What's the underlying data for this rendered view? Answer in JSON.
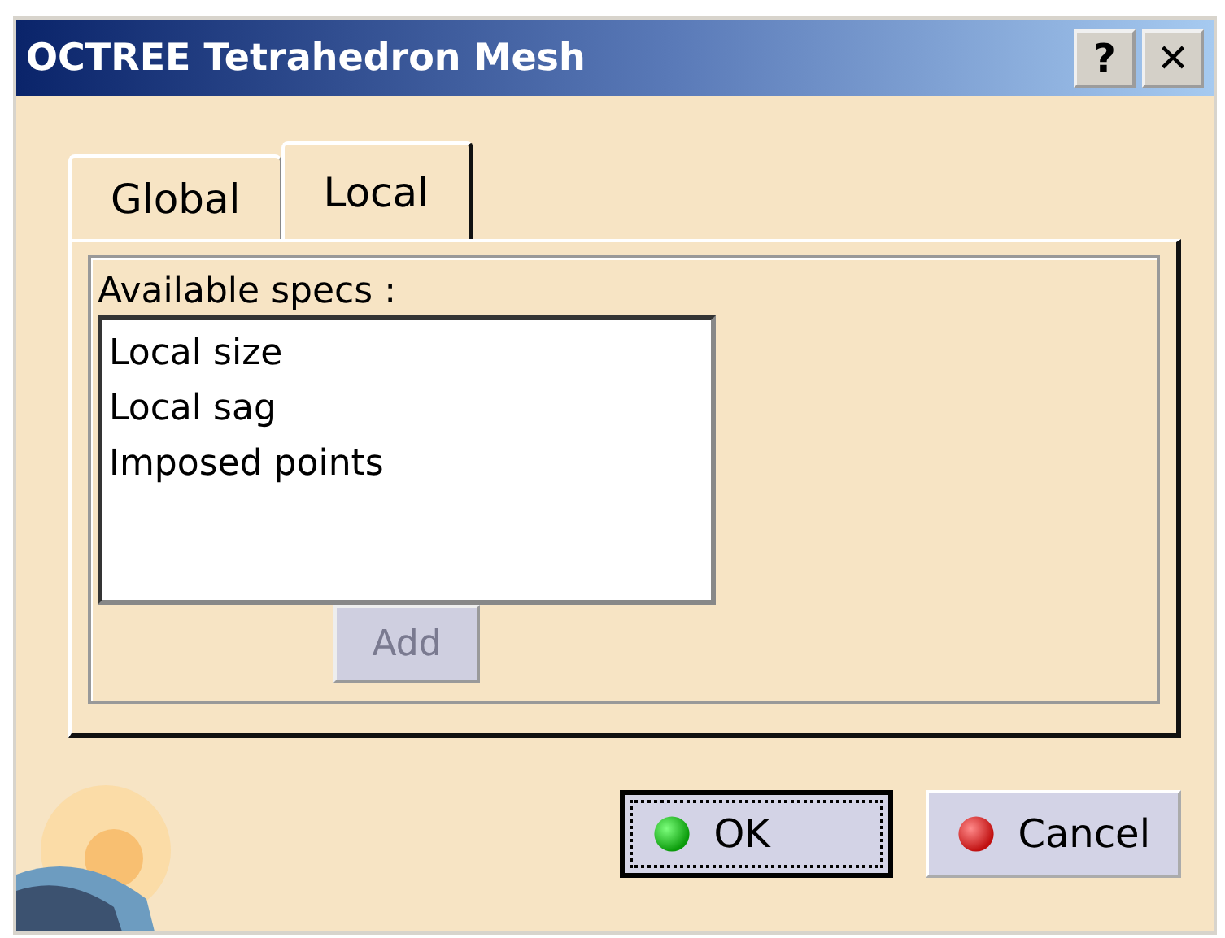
{
  "window": {
    "title": "OCTREE Tetrahedron Mesh",
    "title_buttons": [
      "?",
      "✕"
    ]
  },
  "tabs": [
    {
      "label": "Global",
      "selected": false
    },
    {
      "label": "Local",
      "selected": true
    }
  ],
  "specs": {
    "label": "Available specs :",
    "items": [
      "Local size",
      "Local sag",
      "Imposed points"
    ],
    "add_button": {
      "label": "Add",
      "disabled": true
    }
  },
  "buttons": [
    {
      "label": "OK",
      "kind": "ok",
      "default": true
    },
    {
      "label": "Cancel",
      "kind": "cancel",
      "default": false
    }
  ]
}
